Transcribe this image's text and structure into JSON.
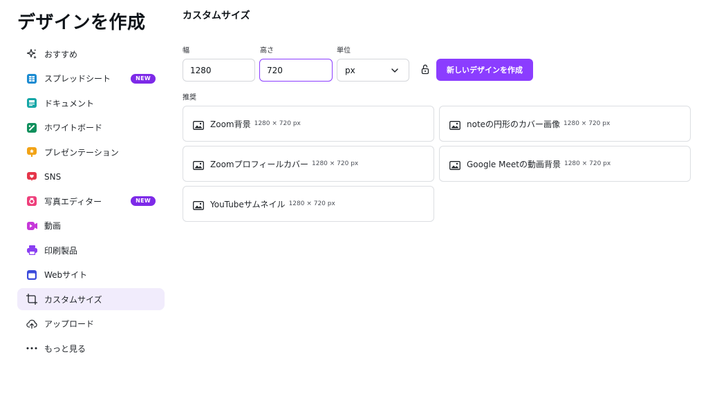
{
  "header": {
    "title": "デザインを作成"
  },
  "sidebar": {
    "items": [
      {
        "label": "おすすめ",
        "icon": "sparkle-icon"
      },
      {
        "label": "スプレッドシート",
        "icon": "spreadsheet-icon",
        "badge": "NEW"
      },
      {
        "label": "ドキュメント",
        "icon": "document-icon"
      },
      {
        "label": "ホワイトボード",
        "icon": "whiteboard-icon"
      },
      {
        "label": "プレゼンテーション",
        "icon": "presentation-icon"
      },
      {
        "label": "SNS",
        "icon": "heart-icon"
      },
      {
        "label": "写真エディター",
        "icon": "camera-icon",
        "badge": "NEW"
      },
      {
        "label": "動画",
        "icon": "video-icon"
      },
      {
        "label": "印刷製品",
        "icon": "printer-icon"
      },
      {
        "label": "Webサイト",
        "icon": "website-icon"
      },
      {
        "label": "カスタムサイズ",
        "icon": "custom-size-icon",
        "active": true
      },
      {
        "label": "アップロード",
        "icon": "upload-cloud-icon"
      },
      {
        "label": "もっと見る",
        "icon": "more-dots-icon"
      }
    ]
  },
  "custom": {
    "title": "カスタムサイズ",
    "width_label": "幅",
    "width_value": "1280",
    "height_label": "高さ",
    "height_value": "720",
    "unit_label": "単位",
    "unit_value": "px",
    "create_button": "新しいデザインを作成",
    "recommend_label": "推奨"
  },
  "recommendations": [
    {
      "name": "Zoom背景",
      "size": "1280 × 720 px"
    },
    {
      "name": "noteの円形のカバー画像",
      "size": "1280 × 720 px"
    },
    {
      "name": "Zoomプロフィールカバー",
      "size": "1280 × 720 px"
    },
    {
      "name": "Google Meetの動画背景",
      "size": "1280 × 720 px"
    },
    {
      "name": "YouTubeサムネイル",
      "size": "1280 × 720 px"
    }
  ],
  "colors": {
    "accent": "#8b3dff",
    "badge": "#7d2ae8",
    "active_bg": "#f1ecfc"
  }
}
